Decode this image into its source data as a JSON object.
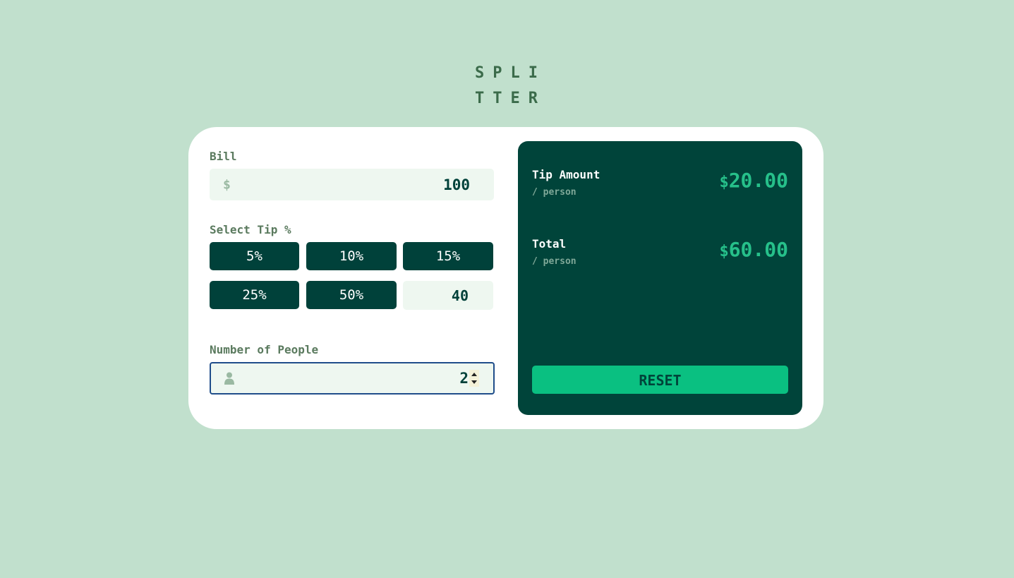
{
  "logo": {
    "line1": "SPLI",
    "line2": "TTER"
  },
  "bill": {
    "label": "Bill",
    "prefix_icon": "dollar-icon",
    "prefix": "$",
    "value": "100"
  },
  "tip": {
    "label": "Select Tip %",
    "options": [
      {
        "label": "5%"
      },
      {
        "label": "10%"
      },
      {
        "label": "15%"
      },
      {
        "label": "25%"
      },
      {
        "label": "50%"
      }
    ],
    "custom_value": "40"
  },
  "people": {
    "label": "Number of People",
    "icon": "person-icon",
    "value": "2"
  },
  "results": {
    "tip_amount": {
      "title": "Tip Amount",
      "sub": "/ person",
      "currency": "$",
      "value": "20.00"
    },
    "total": {
      "title": "Total",
      "sub": "/ person",
      "currency": "$",
      "value": "60.00"
    },
    "reset_label": "RESET"
  },
  "colors": {
    "background": "#c1e0cd",
    "dark_green": "#00413a",
    "accent": "#26c08a",
    "reset_button": "#0ac081",
    "input_bg": "#eef7f0"
  }
}
